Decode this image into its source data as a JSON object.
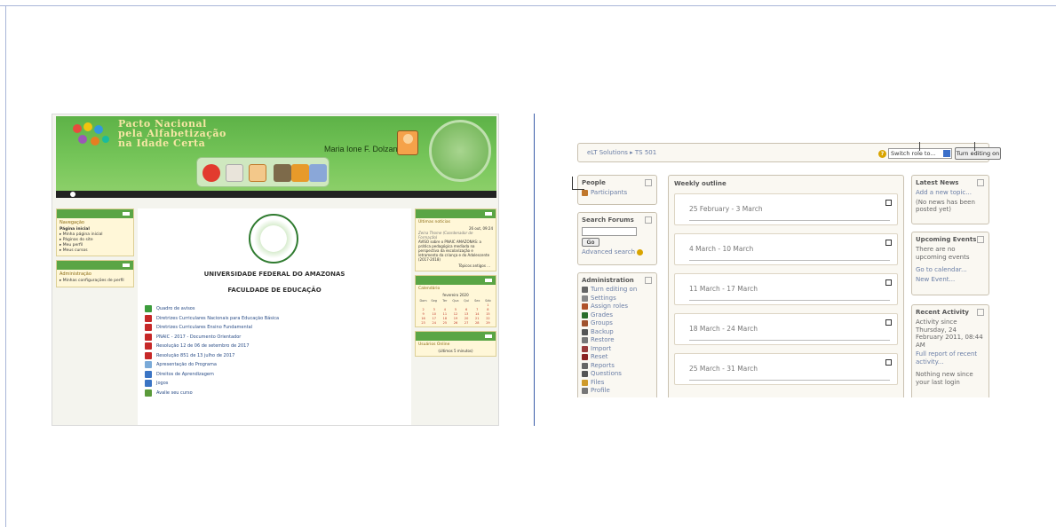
{
  "left_screenshot": {
    "header_title_lines": [
      "Pacto Nacional",
      "pela Alfabetização",
      "na Idade Certa"
    ],
    "user_name": "Maria Ione F. Dolzane ▴",
    "sidebar": {
      "nav_title": "Navegação",
      "nav_items": [
        "Página inicial",
        "▸ Minha página inicial",
        "▸ Páginas do site",
        "▸ Meu perfil",
        "▸ Meus cursos"
      ],
      "admin_title": "Administração",
      "admin_items": [
        "▸ Minhas configurações de perfil"
      ]
    },
    "center": {
      "university": "UNIVERSIDADE FEDERAL DO AMAZONAS",
      "faculty": "FACULDADE DE EDUCAÇÃO",
      "links": [
        {
          "label": "Quadro de avisos",
          "color": "#3c9c3c"
        },
        {
          "label": "Diretrizes Curriculares Nacionais para Educação Básica",
          "color": "#c62828"
        },
        {
          "label": "Diretrizes Curriculares Ensino Fundamental",
          "color": "#c62828"
        },
        {
          "label": "PNAIC - 2017 - Documento Orientador",
          "color": "#c62828"
        },
        {
          "label": "Resolução 12 de 06 de setembro de 2017",
          "color": "#c62828"
        },
        {
          "label": "Resolução 851 de 13 julho de 2017",
          "color": "#c62828"
        },
        {
          "label": "Apresentação do Programa",
          "color": "#7aaad8"
        },
        {
          "label": "Direitos de Aprendizagem",
          "color": "#3a74c4"
        },
        {
          "label": "Jogos",
          "color": "#3a74c4"
        },
        {
          "label": "Avalie seu curso",
          "color": "#5a9a3a"
        }
      ]
    },
    "right_column": {
      "news_title": "Últimas notícias",
      "news_date": "26 out, 09:24",
      "news_author": "Zeina Thome (Coordenador de Formação)",
      "news_body": "AVISO sobre o PNAIC AMAZONAS: a prática pedagógica mediada na perspectiva da escolarização e letramento da criança e do Adolescente (2017-2018)",
      "news_more": "Tópicos antigos ...",
      "calendar_title": "Calendário",
      "calendar_month": "fevereiro 2020",
      "calendar_days": [
        "Dom",
        "Seg",
        "Ter",
        "Qua",
        "Qui",
        "Sex",
        "Sáb"
      ],
      "calendar_dates": [
        "",
        "",
        "",
        "",
        "",
        "",
        "1",
        "2",
        "3",
        "4",
        "5",
        "6",
        "7",
        "8",
        "9",
        "10",
        "11",
        "12",
        "13",
        "14",
        "15",
        "16",
        "17",
        "18",
        "19",
        "20",
        "21",
        "22",
        "23",
        "24",
        "25",
        "26",
        "27",
        "28",
        "29"
      ],
      "online_title": "Usuários Online",
      "online_sub": "(últimos 5 minutos)"
    }
  },
  "right_screenshot": {
    "breadcrumb": "eLT Solutions ▸ TS 501",
    "switch_role": "Switch role to...",
    "turn_editing_button": "Turn editing on",
    "people": {
      "title": "People",
      "items": [
        "Participants"
      ]
    },
    "search_forums": {
      "title": "Search Forums",
      "go": "Go",
      "advanced": "Advanced search"
    },
    "administration": {
      "title": "Administration",
      "items": [
        "Turn editing on",
        "Settings",
        "Assign roles",
        "Grades",
        "Groups",
        "Backup",
        "Restore",
        "Import",
        "Reset",
        "Reports",
        "Questions",
        "Files",
        "Profile"
      ]
    },
    "weekly_outline": {
      "title": "Weekly outline",
      "weeks": [
        "25 February - 3 March",
        "4 March - 10 March",
        "11 March - 17 March",
        "18 March - 24 March",
        "25 March - 31 March"
      ]
    },
    "latest_news": {
      "title": "Latest News",
      "add": "Add a new topic...",
      "empty": "(No news has been posted yet)"
    },
    "upcoming_events": {
      "title": "Upcoming Events",
      "empty": "There are no upcoming events",
      "goto": "Go to calendar...",
      "new": "New Event..."
    },
    "recent_activity": {
      "title": "Recent Activity",
      "since": "Activity since Thursday, 24 February 2011, 08:44 AM",
      "report": "Full report of recent activity...",
      "nothing": "Nothing new since your last login"
    }
  }
}
